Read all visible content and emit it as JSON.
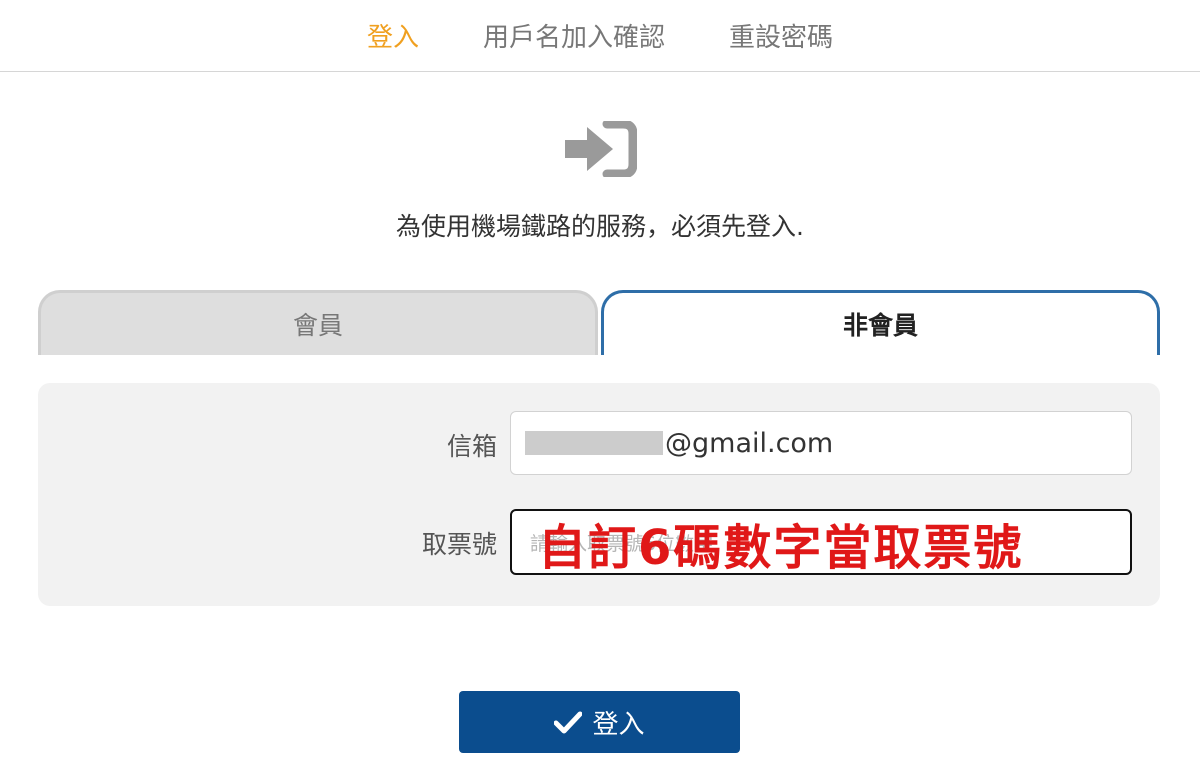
{
  "nav": {
    "items": [
      {
        "label": "登入",
        "active": true
      },
      {
        "label": "用戶名加入確認",
        "active": false
      },
      {
        "label": "重設密碼",
        "active": false
      }
    ]
  },
  "header": {
    "icon": "sign-in-icon",
    "message": "為使用機場鐵路的服務，必須先登入."
  },
  "tabs": [
    {
      "label": "會員",
      "active": false
    },
    {
      "label": "非會員",
      "active": true
    }
  ],
  "form": {
    "email_label": "信箱",
    "email_value": "@gmail.com",
    "ticket_label": "取票號",
    "ticket_placeholder": "請輸入取票號6位數字"
  },
  "annotation": {
    "text": "自訂6碼數字當取票號",
    "color": "#e01818"
  },
  "submit": {
    "label": "登入",
    "icon": "check-icon"
  },
  "colors": {
    "accent": "#f0a020",
    "primary": "#0b4d8e",
    "tab_border": "#2e6ea8"
  }
}
